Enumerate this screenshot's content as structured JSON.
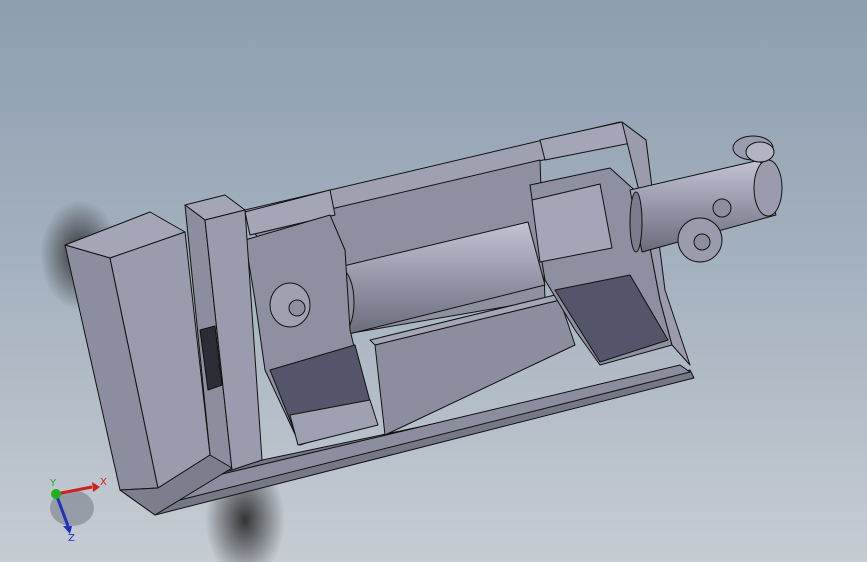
{
  "viewport": {
    "background_top": "#8e9eb0",
    "background_bottom": "#c6ccd3",
    "model": "vise-assembly"
  },
  "triad": {
    "x_label": "X",
    "y_label": "Y",
    "z_label": "Z",
    "x_color": "#d02020",
    "y_color": "#20b020",
    "z_color": "#2030c0"
  },
  "colors": {
    "part_light": "#9fa1b3",
    "part_mid": "#8c8ea0",
    "part_dark": "#5e5f6e",
    "edge": "#111111"
  }
}
